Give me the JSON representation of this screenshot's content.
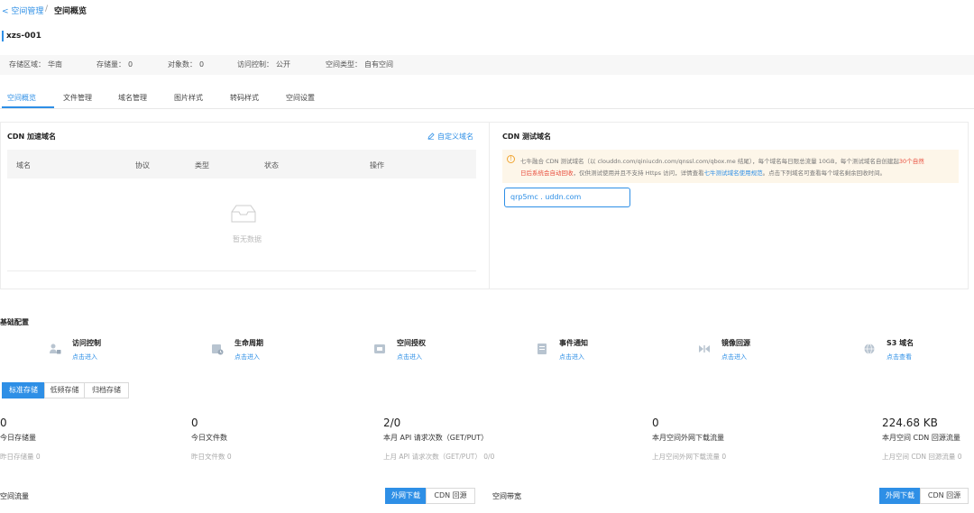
{
  "breadcrumb": {
    "back_label": "< 空间管理",
    "separator": "/",
    "current": "空间概览"
  },
  "bucket": {
    "name": "xzs-001",
    "info": [
      {
        "label": "存储区域：",
        "value": "华南"
      },
      {
        "label": "存储量：",
        "value": "0"
      },
      {
        "label": "对象数：",
        "value": "0"
      },
      {
        "label": "访问控制：",
        "value": "公开"
      },
      {
        "label": "空间类型：",
        "value": "自有空间"
      }
    ]
  },
  "tabs": [
    {
      "label": "空间概览",
      "active": true
    },
    {
      "label": "文件管理"
    },
    {
      "label": "域名管理"
    },
    {
      "label": "图片样式"
    },
    {
      "label": "转码样式"
    },
    {
      "label": "空间设置"
    }
  ],
  "cdn_panel": {
    "title": "CDN 加速域名",
    "custom_domain_label": "自定义域名",
    "columns": [
      "域名",
      "协议",
      "类型",
      "状态",
      "操作"
    ],
    "empty_text": "暂无数据"
  },
  "test_panel": {
    "title": "CDN 测试域名",
    "warning": {
      "line1_a": "七牛融合 CDN 测试域名（以 clouddn.com/qiniucdn.com/qnssl.com/qbox.me 结尾），每个域名每日限总流量 10GB，每个测试域名自创建起",
      "line1_red": "30个自然",
      "line2_red": "日后系统会自动回收",
      "line2_b": "，仅供测试使用并且不支持 Https 访问，详情查看",
      "line2_link": "七牛测试域名使用规范",
      "line2_c": "。点击下列域名可查看每个域名剩余回收时间。"
    },
    "test_domain": "qrp5mc      .          uddn.com"
  },
  "config": {
    "title": "基础配置",
    "items": [
      {
        "name": "访问控制",
        "link": "点击进入",
        "icon": "user-lock-icon"
      },
      {
        "name": "生命周期",
        "link": "点击进入",
        "icon": "lifecycle-icon"
      },
      {
        "name": "空间授权",
        "link": "点击进入",
        "icon": "authorize-icon"
      },
      {
        "name": "事件通知",
        "link": "点击进入",
        "icon": "notify-icon"
      },
      {
        "name": "镜像回源",
        "link": "点击进入",
        "icon": "mirror-icon"
      },
      {
        "name": "S3 域名",
        "link": "点击查看",
        "icon": "globe-icon"
      }
    ]
  },
  "storage_types": [
    {
      "label": "标准存储",
      "active": true
    },
    {
      "label": "低频存储"
    },
    {
      "label": "归档存储"
    }
  ],
  "stats": [
    {
      "value": "0",
      "label": "今日存储量",
      "sub": "昨日存储量 0"
    },
    {
      "value": "0",
      "label": "今日文件数",
      "sub": "昨日文件数 0"
    },
    {
      "value": "2/0",
      "label": "本月 API 请求次数（GET/PUT）",
      "sub": "上月 API 请求次数（GET/PUT） 0/0"
    },
    {
      "value": "0",
      "label": "本月空间外网下载流量",
      "sub": "上月空间外网下载流量 0"
    },
    {
      "value": "224.68 KB",
      "label": "本月空间 CDN 回源流量",
      "sub": "上月空间 CDN 回源流量 0"
    }
  ],
  "traffic": {
    "title": "空间流量",
    "buttons": [
      {
        "label": "外网下载",
        "active": true
      },
      {
        "label": "CDN 回源"
      }
    ]
  },
  "bandwidth": {
    "title": "空间带宽",
    "buttons": [
      {
        "label": "外网下载",
        "active": true
      },
      {
        "label": "CDN 回源"
      }
    ]
  },
  "colors": {
    "accent": "#2e8fe6",
    "warning_bg": "#fdf6e9",
    "warning_icon": "#f0a532",
    "warning_red": "#e84d3d",
    "icon_gray": "#b8c4d0"
  }
}
